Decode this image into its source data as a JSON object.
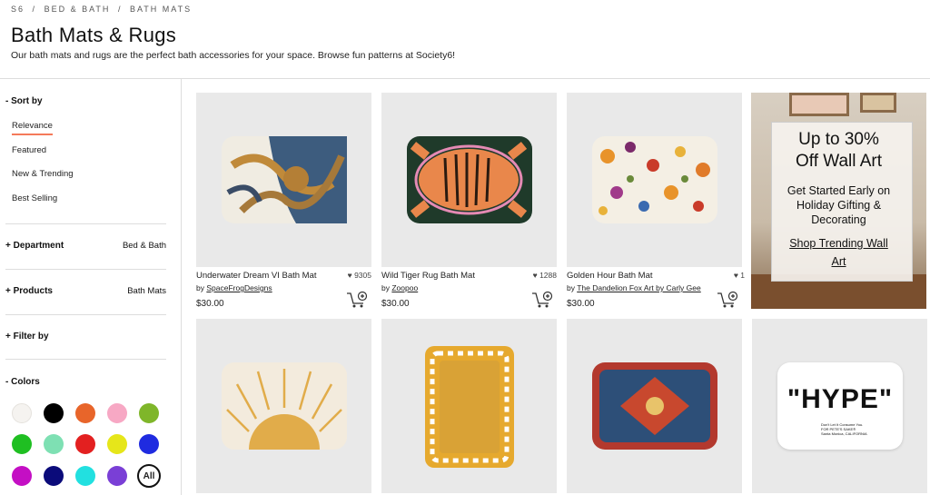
{
  "breadcrumb": [
    "S6",
    "/",
    "BED & BATH",
    "/",
    "BATH MATS"
  ],
  "page": {
    "title": "Bath Mats & Rugs",
    "description": "Our bath mats and rugs are the perfect bath accessories for your space. Browse fun patterns at Society6!"
  },
  "sidebar": {
    "sort_by": "- Sort by",
    "sort_options": [
      "Relevance",
      "Featured",
      "New & Trending",
      "Best Selling"
    ],
    "department": {
      "label": "+ Department",
      "value": "Bed & Bath"
    },
    "products": {
      "label": "+ Products",
      "value": "Bath Mats"
    },
    "filter_by": "+ Filter by",
    "colors": {
      "label": "- Colors",
      "swatches": [
        "#f5f3f0",
        "#000000",
        "#e8652a",
        "#f7a8c4",
        "#7fb62a",
        "#1fbf22",
        "#7ee0b3",
        "#e32020",
        "#e6e61a",
        "#1f2be0",
        "#c40fc4",
        "#0b0b7a",
        "#22e0e0",
        "#7a3fd6"
      ],
      "all_label": "All"
    }
  },
  "products": [
    {
      "title": "Underwater Dream VI Bath Mat",
      "likes": "9305",
      "by": "by",
      "artist": "SpaceFrogDesigns",
      "price": "$30.00"
    },
    {
      "title": "Wild Tiger Rug Bath Mat",
      "likes": "1288",
      "by": "by",
      "artist": "Zoopoo",
      "price": "$30.00"
    },
    {
      "title": "Golden Hour Bath Mat",
      "likes": "1",
      "by": "by",
      "artist": "The Dandelion Fox Art by Carly Gee",
      "price": "$30.00"
    }
  ],
  "promo": {
    "headline_1": "Up to 30%",
    "headline_2": "Off Wall Art",
    "sub_1": "Get Started Early on",
    "sub_2": "Holiday Gifting &",
    "sub_3": "Decorating",
    "link_1": "Shop Trending Wall",
    "link_2": "Art"
  },
  "hype_mat": {
    "headline": "\"HYPE\"",
    "line_1": "Don't Let It Consume You.",
    "line_2": "FOR PETE'S SAKE®",
    "line_3": "Santa Monica, CALIFORNIA"
  },
  "colors": {
    "accent": "#f47a5a"
  }
}
